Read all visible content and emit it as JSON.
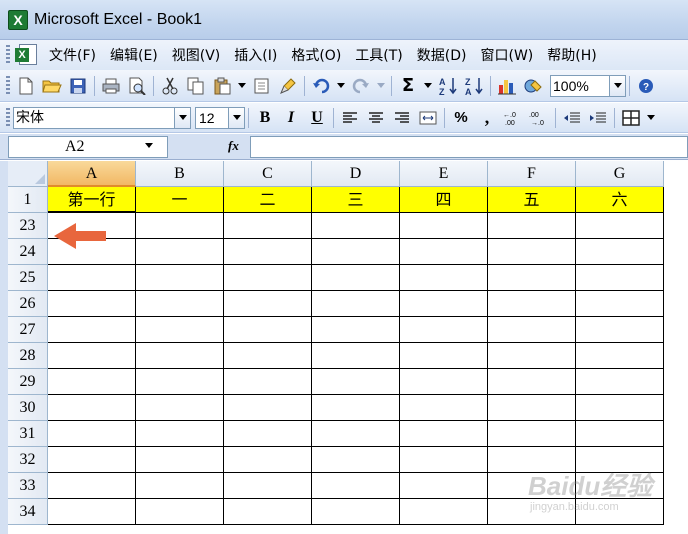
{
  "window": {
    "title": "Microsoft Excel - Book1"
  },
  "menu": [
    "文件(F)",
    "编辑(E)",
    "视图(V)",
    "插入(I)",
    "格式(O)",
    "工具(T)",
    "数据(D)",
    "窗口(W)",
    "帮助(H)"
  ],
  "toolbar": {
    "zoom": "100%",
    "sum_symbol": "Σ"
  },
  "format_toolbar": {
    "font": "宋体",
    "size": "12",
    "bold": "B",
    "italic": "I",
    "underline": "U",
    "percent": "%",
    "comma": ","
  },
  "formula_bar": {
    "name_box": "A2",
    "fx": "fx",
    "content": ""
  },
  "sheet": {
    "columns": [
      "A",
      "B",
      "C",
      "D",
      "E",
      "F",
      "G"
    ],
    "active_column": "A",
    "rows": [
      "1",
      "23",
      "24",
      "25",
      "26",
      "27",
      "28",
      "29",
      "30",
      "31",
      "32",
      "33",
      "34"
    ],
    "header_row": [
      "第一行",
      "一",
      "二",
      "三",
      "四",
      "五",
      "六"
    ],
    "header_fill": "#ffff00",
    "arrow_color": "#e8663d"
  },
  "watermark": {
    "main": "Baidu经验",
    "sub": "jingyan.baidu.com"
  }
}
